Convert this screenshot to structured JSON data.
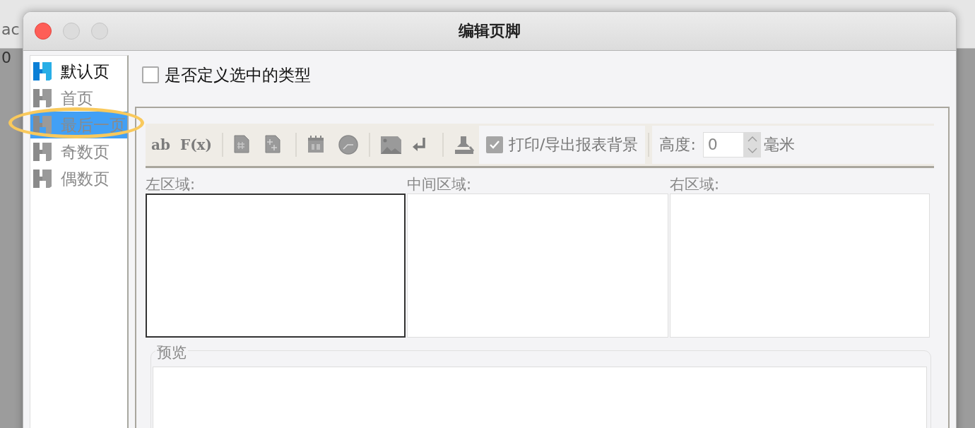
{
  "background_app": {
    "toolbar_text": "ac",
    "ruler_text": "0"
  },
  "window": {
    "title": "编辑页脚",
    "buttons": [
      {
        "kind": "close",
        "active": true
      },
      {
        "kind": "minimize",
        "active": false
      },
      {
        "kind": "zoom",
        "active": false
      }
    ]
  },
  "sidebar": {
    "items": [
      {
        "label": "默认页",
        "defined": true,
        "selected": false
      },
      {
        "label": "首页",
        "defined": false,
        "selected": false
      },
      {
        "label": "最后一页",
        "defined": false,
        "selected": true
      },
      {
        "label": "奇数页",
        "defined": false,
        "selected": false
      },
      {
        "label": "偶数页",
        "defined": false,
        "selected": false
      }
    ]
  },
  "annotation": {
    "kind": "ellipse",
    "color": "#f9c95c"
  },
  "define_type_checkbox": {
    "label": "是否定义选中的类型",
    "checked": false
  },
  "toolbar": {
    "items": [
      {
        "kind": "glyph",
        "text": "ab"
      },
      {
        "kind": "glyph",
        "text": "F(x)"
      },
      {
        "kind": "separator"
      },
      {
        "kind": "pagenumber"
      },
      {
        "kind": "pagecount"
      },
      {
        "kind": "separator"
      },
      {
        "kind": "date"
      },
      {
        "kind": "time"
      },
      {
        "kind": "separator"
      },
      {
        "kind": "image"
      },
      {
        "kind": "linebreak"
      },
      {
        "kind": "separator"
      },
      {
        "kind": "background"
      }
    ],
    "print_background": {
      "label": "打印/导出报表背景",
      "checked": true,
      "disabled": true
    },
    "height": {
      "label": "高度:",
      "value": "0",
      "unit": "毫米"
    }
  },
  "zones": [
    {
      "label": "左区域:",
      "selected": true
    },
    {
      "label": "中间区域:",
      "selected": false
    },
    {
      "label": "右区域:",
      "selected": false
    }
  ],
  "preview": {
    "label": "预览"
  }
}
